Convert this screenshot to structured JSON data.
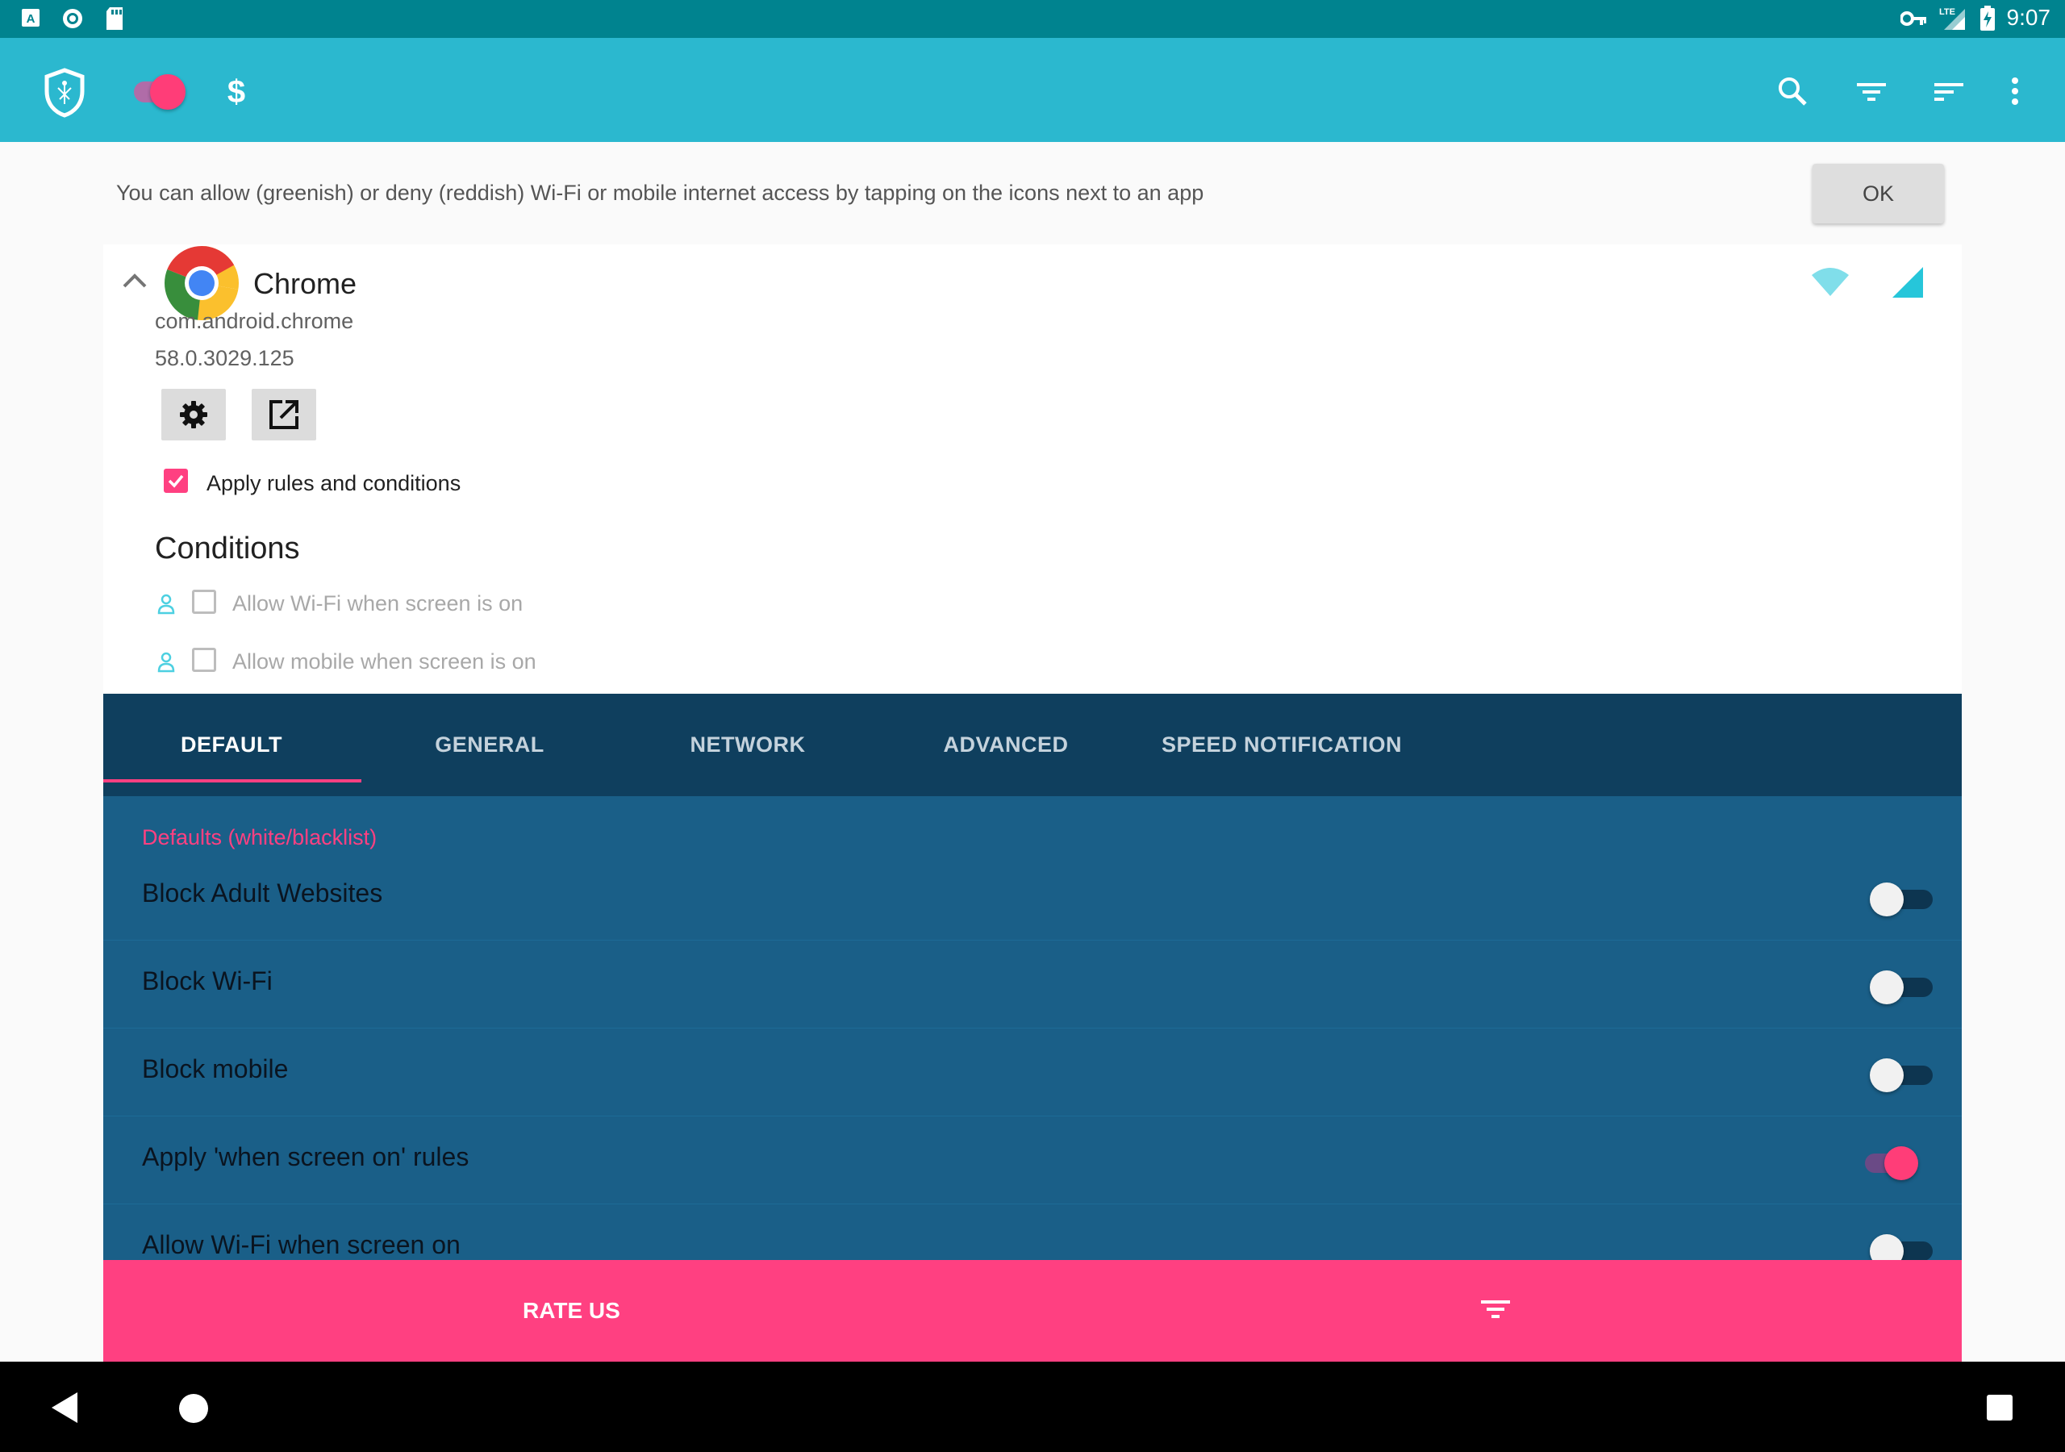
{
  "status_bar": {
    "time": "9:07",
    "network": "LTE"
  },
  "hint": {
    "text": "You can allow (greenish) or deny (reddish) Wi-Fi or mobile internet access by tapping on the icons next to an app",
    "ok_label": "OK"
  },
  "app": {
    "name": "Chrome",
    "package": "com.android.chrome",
    "version": "58.0.3029.125",
    "apply_rules_label": "Apply rules and conditions",
    "apply_rules_checked": true,
    "conditions_title": "Conditions",
    "conditions": [
      {
        "label": "Allow Wi-Fi when screen is on",
        "checked": false
      },
      {
        "label": "Allow mobile when screen is on",
        "checked": false
      }
    ]
  },
  "tabs": [
    {
      "label": "DEFAULT",
      "active": true
    },
    {
      "label": "GENERAL",
      "active": false
    },
    {
      "label": "NETWORK",
      "active": false
    },
    {
      "label": "ADVANCED",
      "active": false
    },
    {
      "label": "SPEED NOTIFICATION",
      "active": false
    }
  ],
  "settings": {
    "section_title": "Defaults (white/blacklist)",
    "items": [
      {
        "label": "Block Adult Websites",
        "on": false
      },
      {
        "label": "Block Wi-Fi",
        "on": false
      },
      {
        "label": "Block mobile",
        "on": false
      },
      {
        "label": "Apply 'when screen on' rules",
        "on": true
      },
      {
        "label": "Allow Wi-Fi when screen on",
        "on": false
      }
    ]
  },
  "bottom_bar": {
    "rate_label": "RATE US"
  },
  "colors": {
    "toolbar": "#2bb8cf",
    "status_bar": "#00838f",
    "accent": "#ff4081",
    "panel": "#1a5f88",
    "tabs": "#0f3f5e"
  },
  "icons": [
    "shield-icon",
    "master-switch",
    "dollar-icon",
    "search-icon",
    "filter-icon",
    "sort-icon",
    "overflow-menu-icon",
    "wifi-icon",
    "cellular-icon",
    "settings-gear-icon",
    "launch-icon"
  ]
}
